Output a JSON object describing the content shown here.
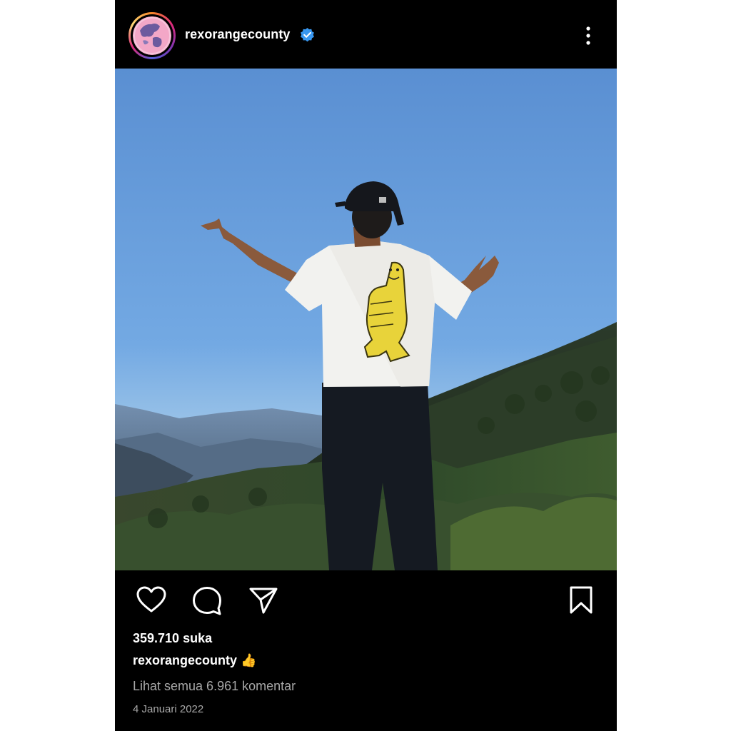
{
  "post": {
    "username": "rexorangecounty",
    "verified_icon": "verified-badge-icon",
    "more_icon": "more-vertical-icon",
    "image": {
      "description_icon": "post-photo"
    },
    "actions": {
      "like_icon": "heart-icon",
      "comment_icon": "comment-icon",
      "share_icon": "send-icon",
      "save_icon": "bookmark-icon"
    },
    "likes": "359.710 suka",
    "caption": {
      "username": "rexorangecounty",
      "text": "👍"
    },
    "view_comments": "Lihat semua 6.961 komentar",
    "date": "4 Januari 2022"
  },
  "colors": {
    "background": "#000000",
    "text": "#ffffff",
    "muted": "#a8a8a8",
    "verified": "#3897f0",
    "sky": "#5a92d6"
  }
}
